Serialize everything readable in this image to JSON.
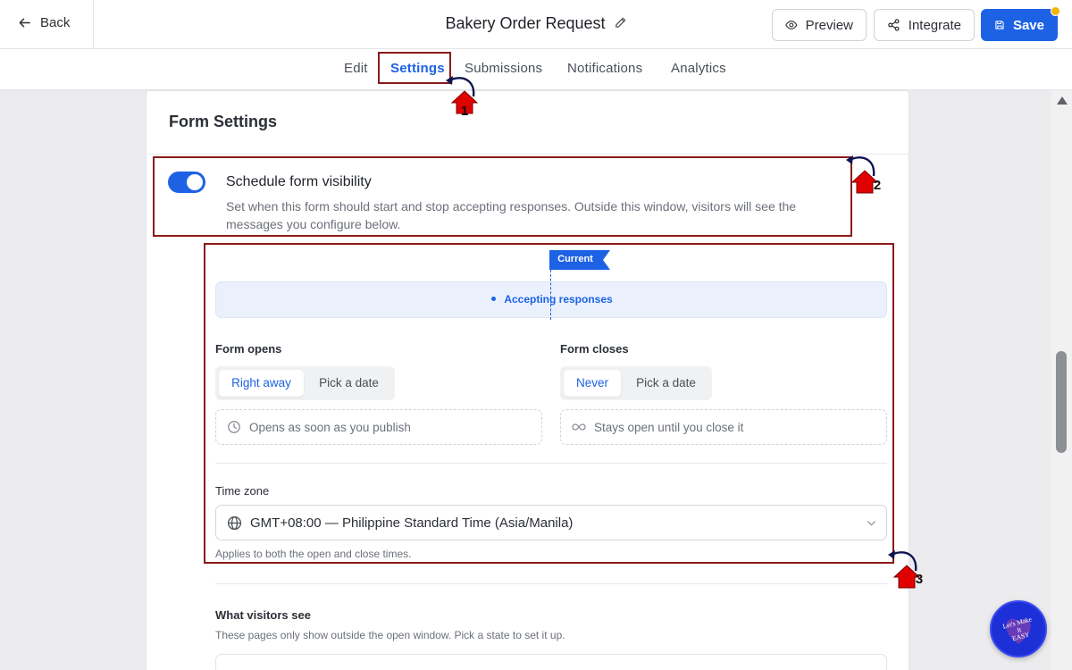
{
  "topbar": {
    "back_label": "Back",
    "title": "Bakery Order Request",
    "preview_label": "Preview",
    "integrate_label": "Integrate",
    "save_label": "Save"
  },
  "tabs": [
    {
      "label": "Edit",
      "active": false
    },
    {
      "label": "Settings",
      "active": true
    },
    {
      "label": "Submissions",
      "active": false
    },
    {
      "label": "Notifications",
      "active": false
    },
    {
      "label": "Analytics",
      "active": false
    }
  ],
  "form_settings": {
    "title": "Form Settings",
    "schedule": {
      "enabled": true,
      "title": "Schedule form visibility",
      "description": "Set when this form should start and stop accepting responses. Outside this window, visitors will see the messages you configure below."
    },
    "timeline": {
      "current_label": "Current",
      "status": "Accepting responses"
    },
    "opens": {
      "label": "Form opens",
      "options": [
        "Right away",
        "Pick a date"
      ],
      "selected": "Right away",
      "info": "Opens as soon as you publish"
    },
    "closes": {
      "label": "Form closes",
      "options": [
        "Never",
        "Pick a date"
      ],
      "selected": "Never",
      "info": "Stays open until you close it"
    },
    "timezone": {
      "label": "Time zone",
      "value": "GMT+08:00 — Philippine Standard Time (Asia/Manila)",
      "help": "Applies to both the open and close times."
    },
    "visitors": {
      "title": "What visitors see",
      "description": "These pages only show outside the open window. Pick a state to set it up."
    }
  },
  "annotations": [
    "1",
    "2",
    "3"
  ],
  "badge": {
    "text": "Let's Make It EASY"
  },
  "colors": {
    "accent": "#1d62e5",
    "annotation_box": "#8b1a1a",
    "annotation_arrow": "#e00000",
    "status_bg": "#eaf1fc"
  }
}
